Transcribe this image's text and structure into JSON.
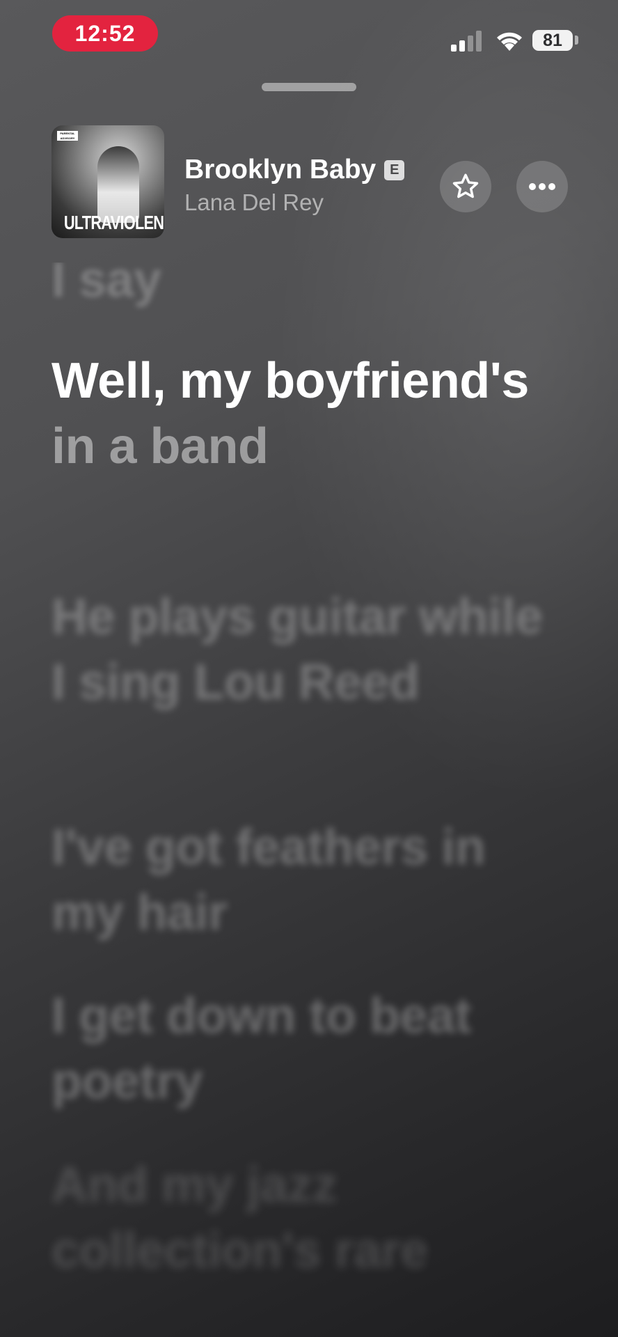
{
  "status_bar": {
    "time": "12:52",
    "battery": "81"
  },
  "now_playing": {
    "title": "Brooklyn Baby",
    "explicit_badge": "E",
    "artist": "Lana Del Rey",
    "album_art_text": "ULTRAVIOLENCE",
    "advisory_text": "PARENTAL ADVISORY"
  },
  "lyrics": {
    "previous": "I say",
    "current_sung": "Well, my boyfriend's",
    "current_upcoming": "in a band",
    "upcoming": [
      "He plays guitar while I sing Lou Reed",
      "I've got feathers in my hair",
      "I get down to beat poetry",
      "And my jazz collection's rare"
    ]
  },
  "icons": [
    "star-icon",
    "more-icon",
    "signal-icon",
    "wifi-icon",
    "battery-icon"
  ]
}
